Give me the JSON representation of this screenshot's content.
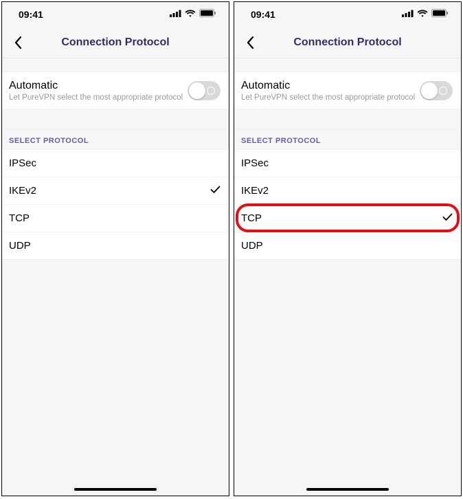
{
  "screens": [
    {
      "id": "left",
      "status": {
        "time": "09:41"
      },
      "header": {
        "title": "Connection Protocol"
      },
      "automatic": {
        "label": "Automatic",
        "sub": "Let PureVPN select the most appropriate protocol",
        "on": false
      },
      "section_label": "SELECT PROTOCOL",
      "protocols": {
        "ipsec": {
          "label": "IPSec",
          "selected": false
        },
        "ikev2": {
          "label": "IKEv2",
          "selected": true
        },
        "tcp": {
          "label": "TCP",
          "selected": false
        },
        "udp": {
          "label": "UDP",
          "selected": false
        }
      },
      "highlight": null
    },
    {
      "id": "right",
      "status": {
        "time": "09:41"
      },
      "header": {
        "title": "Connection Protocol"
      },
      "automatic": {
        "label": "Automatic",
        "sub": "Let PureVPN select the most appropriate protocol",
        "on": false
      },
      "section_label": "SELECT PROTOCOL",
      "protocols": {
        "ipsec": {
          "label": "IPSec",
          "selected": false
        },
        "ikev2": {
          "label": "IKEv2",
          "selected": false
        },
        "tcp": {
          "label": "TCP",
          "selected": true
        },
        "udp": {
          "label": "UDP",
          "selected": false
        }
      },
      "highlight": "tcp"
    }
  ]
}
